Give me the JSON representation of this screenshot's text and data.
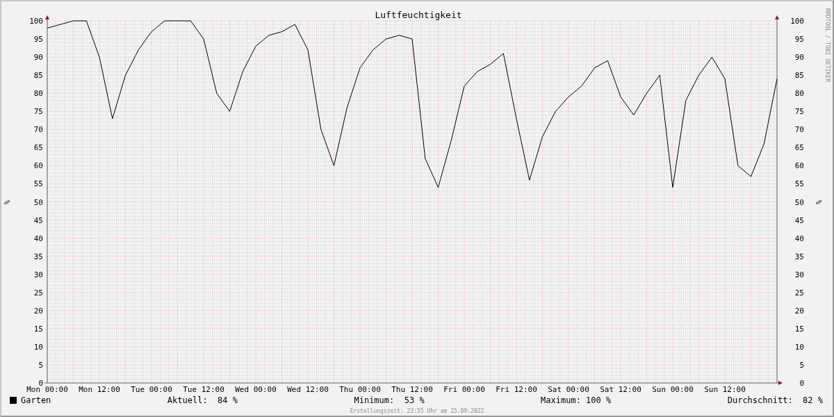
{
  "chart": {
    "chart_data": {
      "type": "line",
      "title": "Luftfeuchtigkeit",
      "ylabel": "%",
      "ylim": [
        0,
        100
      ],
      "grid": true,
      "categories": [
        "Mon 00:00",
        null,
        null,
        null,
        "Mon 12:00",
        null,
        null,
        null,
        "Tue 00:00",
        null,
        null,
        null,
        "Tue 12:00",
        null,
        null,
        null,
        "Wed 00:00",
        null,
        null,
        null,
        "Wed 12:00",
        null,
        null,
        null,
        "Thu 00:00",
        null,
        null,
        null,
        "Thu 12:00",
        null,
        null,
        null,
        "Fri 00:00",
        null,
        null,
        null,
        "Fri 12:00",
        null,
        null,
        null,
        "Sat 00:00",
        null,
        null,
        null,
        "Sat 12:00",
        null,
        null,
        null,
        "Sun 00:00",
        null,
        null,
        null,
        "Sun 12:00",
        null,
        null,
        null,
        null
      ],
      "yticks": [
        0,
        5,
        10,
        15,
        20,
        25,
        30,
        35,
        40,
        45,
        50,
        55,
        60,
        65,
        70,
        75,
        80,
        85,
        90,
        95,
        100
      ],
      "series": [
        {
          "name": "Garten",
          "color": "#000000",
          "values": [
            98,
            99,
            100,
            100,
            90,
            73,
            85,
            92,
            97,
            100,
            100,
            100,
            95,
            80,
            75,
            86,
            93,
            96,
            97,
            99,
            92,
            70,
            60,
            76,
            87,
            92,
            95,
            96,
            95,
            62,
            54,
            67,
            82,
            86,
            88,
            91,
            73,
            56,
            68,
            75,
            79,
            82,
            87,
            89,
            79,
            74,
            80,
            85,
            54,
            78,
            85,
            90,
            84,
            60,
            57,
            66,
            84
          ]
        }
      ]
    },
    "right_yticks": [
      "100",
      "95",
      "90",
      "85",
      "80",
      "75",
      "70",
      "65",
      "60",
      "55",
      "50",
      "45",
      "40",
      "35",
      "30",
      "25",
      "20",
      "15",
      "10",
      "5",
      "0"
    ],
    "right_label": "%",
    "watermark": "RRDTOOL / TOBI OETIKER"
  },
  "legend": {
    "current": {
      "label": "Aktuell:",
      "value": "84 %"
    },
    "minimum": {
      "label": "Minimum:",
      "value": "53 %"
    },
    "maximum": {
      "label": "Maximum:",
      "value": "100 %"
    },
    "average": {
      "label": "Durchschnitt:",
      "value": "82 %"
    }
  },
  "footer": "Erstellungszeit: 23:55 Uhr am 25.09.2022"
}
